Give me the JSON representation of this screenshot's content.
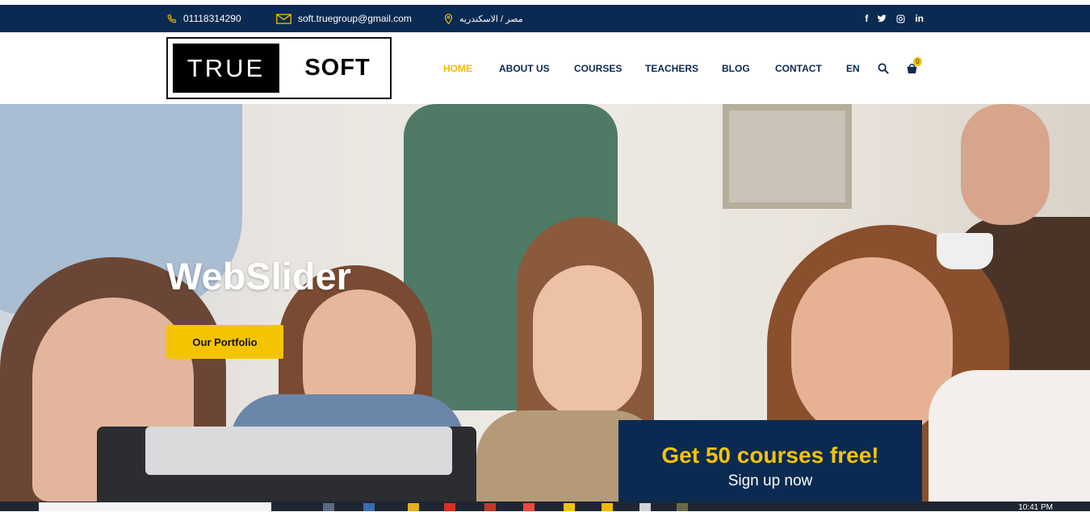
{
  "topbar": {
    "phone": "01118314290",
    "email": "soft.truegroup@gmail.com",
    "location": "مصر / الاسكندريه",
    "social": [
      "facebook-icon",
      "twitter-icon",
      "instagram-icon",
      "linkedin-icon"
    ],
    "social_labels": [
      "f",
      "t",
      "ig",
      "in"
    ]
  },
  "logo": {
    "left": "TRUE",
    "right": "SOFT"
  },
  "nav": {
    "items": [
      "HOME",
      "ABOUT US",
      "COURSES",
      "TEACHERS",
      "BLOG",
      "CONTACT",
      "EN"
    ],
    "active": "HOME",
    "cart_count": "0"
  },
  "hero": {
    "title": "WebSlider",
    "button": "Our Portfolio",
    "promo_title": "Get 50 courses free!",
    "promo_subtitle": "Sign up now"
  },
  "taskbar": {
    "time": "10:41 PM"
  },
  "colors": {
    "navy": "#0b2a52",
    "accent": "#f5c400",
    "white": "#ffffff"
  }
}
